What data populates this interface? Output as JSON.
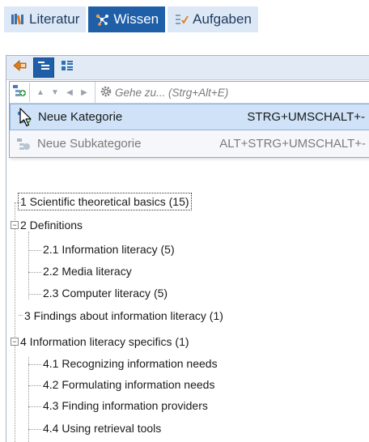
{
  "tabs": [
    {
      "label": "Literatur",
      "icon": "books-icon",
      "active": false
    },
    {
      "label": "Wissen",
      "icon": "knowledge-network-icon",
      "active": true
    },
    {
      "label": "Aufgaben",
      "icon": "tasks-icon",
      "active": false
    }
  ],
  "goto": {
    "placeholder": "Gehe zu... (Strg+Alt+E)"
  },
  "menu": {
    "items": [
      {
        "label": "Neue Kategorie",
        "shortcut": "STRG+UMSCHALT+-",
        "state": "hover"
      },
      {
        "label": "Neue Subkategorie",
        "shortcut": "ALT+STRG+UMSCHALT+-",
        "state": "disabled"
      }
    ]
  },
  "tree": {
    "items": [
      {
        "label": "1 Scientific theoretical basics (15)",
        "level": 0,
        "selected": true
      },
      {
        "label": "2 Definitions",
        "level": 0,
        "expanded": true
      },
      {
        "label": "2.1 Information literacy (5)",
        "level": 1
      },
      {
        "label": "2.2 Media literacy",
        "level": 1
      },
      {
        "label": "2.3 Computer literacy (5)",
        "level": 1
      },
      {
        "label": "3 Findings about information literacy (1)",
        "level": 0
      },
      {
        "label": "4 Information literacy specifics (1)",
        "level": 0,
        "expanded": true
      },
      {
        "label": "4.1 Recognizing information needs",
        "level": 1
      },
      {
        "label": "4.2 Formulating information needs",
        "level": 1
      },
      {
        "label": "4.3 Finding information providers",
        "level": 1
      },
      {
        "label": "4.4 Using retrieval tools",
        "level": 1
      }
    ]
  },
  "colors": {
    "accent": "#1f5fa8",
    "tab_bg": "#dce8f5",
    "hover": "#cfe2f8"
  }
}
